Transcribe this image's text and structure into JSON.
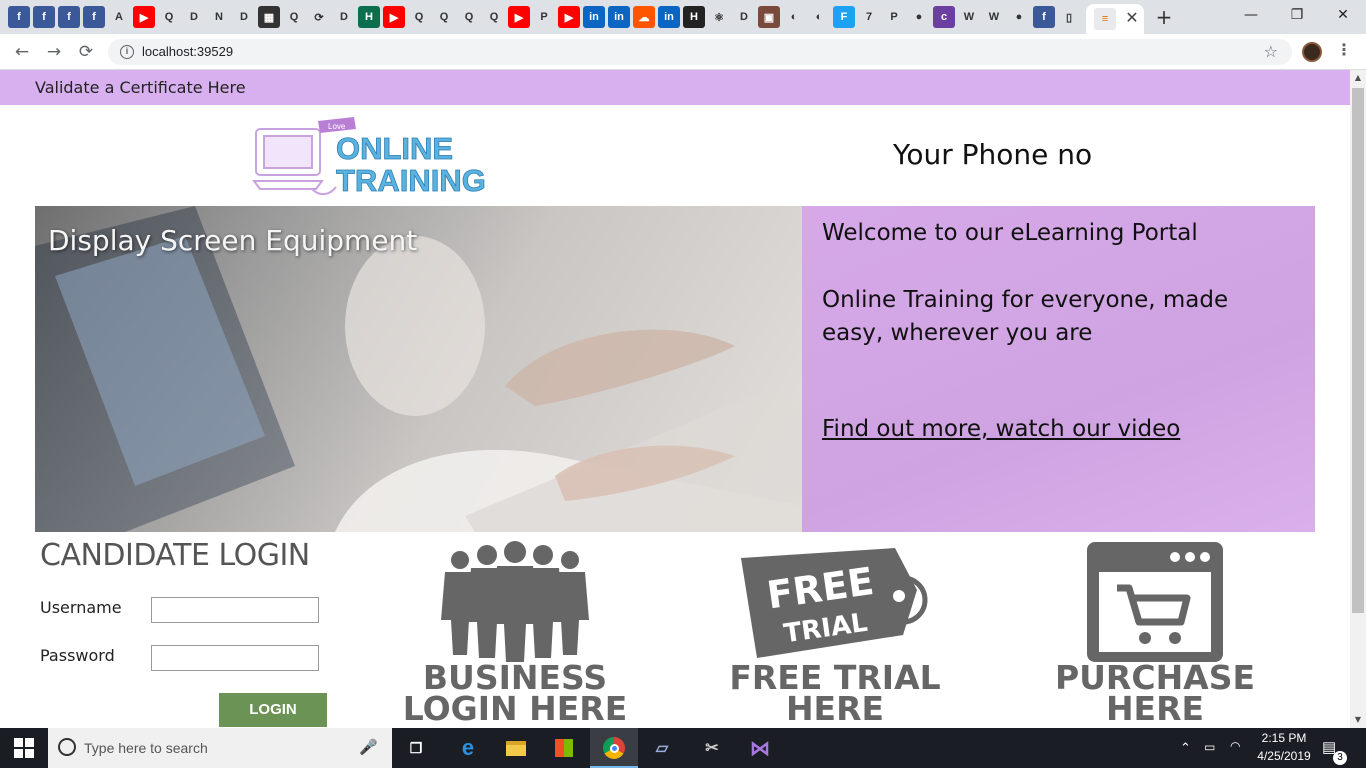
{
  "browser": {
    "url": "localhost:39529",
    "new_tab_glyph": "+",
    "tab_close_glyph": "✕",
    "window_controls": [
      "—",
      "❐",
      "✕"
    ],
    "nav_glyphs": {
      "back": "←",
      "forward": "→",
      "reload": "⟳"
    },
    "bookmark_glyph": "☆",
    "menu_glyph": "⋮"
  },
  "site": {
    "validate_link": "Validate a Certificate Here",
    "logo": {
      "badge": "Love",
      "line1": "ONLINE",
      "line2": "TRAINING"
    },
    "phone": "Your Phone no",
    "hero": {
      "title": "Display Screen Equipment",
      "welcome": "Welcome to our eLearning Portal",
      "tagline": "Online Training for everyone, made easy, wherever you are",
      "video_link": "Find out more, watch our video"
    },
    "login": {
      "heading": "CANDIDATE LOGIN",
      "username_label": "Username",
      "password_label": "Password",
      "username_value": "",
      "password_value": "",
      "button": "LOGIN"
    },
    "features": {
      "business": "BUSINESS LOGIN HERE",
      "trial": "FREE TRIAL HERE",
      "trial_tag_line1": "FREE",
      "trial_tag_line2": "TRIAL",
      "purchase": "PURCHASE HERE"
    }
  },
  "taskbar": {
    "search_placeholder": "Type here to search",
    "time": "2:15 PM",
    "date": "4/25/2019",
    "notification_count": "3"
  },
  "colors": {
    "topbar": "#d8b0ef",
    "hero_panel": "#d6a8e8",
    "login_button": "#6b9355",
    "feature_gray": "#666666"
  }
}
